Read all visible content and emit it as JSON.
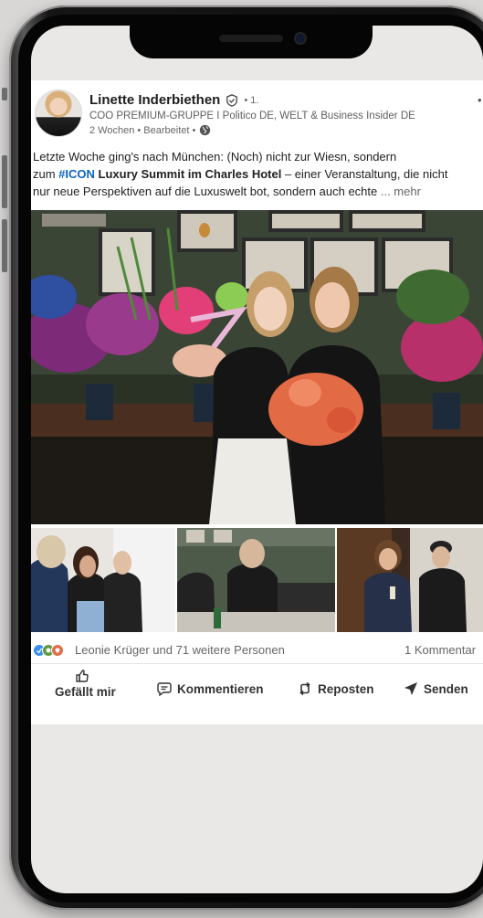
{
  "post": {
    "author_name": "Linette Inderbiethen",
    "degree": "• 1.",
    "headline": "COO PREMIUM-GRUPPE I Politico DE, WELT & Business Insider DE",
    "meta": "2 Wochen • Bearbeitet •",
    "text_line1": "Letzte Woche ging's nach München: (Noch) nicht zur Wiesn, sondern",
    "text_line2_prefix": "zum ",
    "hashtag": "#ICON",
    "text_line2_bold": " Luxury Summit im Charles Hotel",
    "text_line2_suffix": " – einer Veranstaltung, die nicht",
    "text_line3": "nur neue Perspektiven auf die Luxuswelt bot, sondern auch echte ",
    "more": "... mehr"
  },
  "reactions": {
    "summary": "Leonie Krüger und 71 weitere Personen",
    "comments": "1 Kommentar"
  },
  "actions": {
    "like": "Gefällt mir",
    "comment": "Kommentieren",
    "repost": "Reposten",
    "send": "Senden"
  },
  "icons": [
    "verified-icon",
    "globe-icon",
    "like-icon",
    "comment-icon",
    "repost-icon",
    "send-icon",
    "reaction-icons"
  ],
  "colors": {
    "hashtag": "#0a66c2",
    "text": "#222222",
    "muted": "#666666",
    "background": "#e9e8e6"
  }
}
